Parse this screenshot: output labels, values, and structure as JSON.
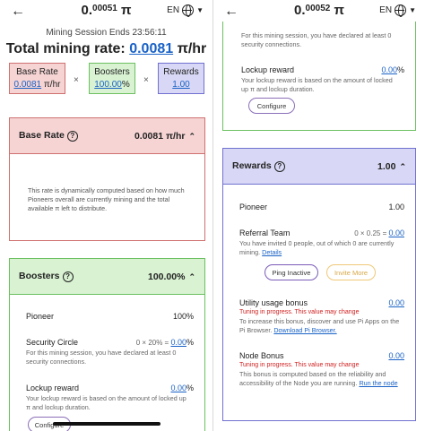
{
  "left": {
    "header": {
      "balance_main": "0.",
      "balance_small": "00051",
      "balance_unit": " π",
      "lang": "EN"
    },
    "session": "Mining Session Ends 23:56:11",
    "total": {
      "label": "Total mining rate: ",
      "value": "0.0081",
      "unit": " π/hr"
    },
    "chips": {
      "base": {
        "label": "Base Rate",
        "value": "0.0081",
        "unit": " π/hr"
      },
      "boosters": {
        "label": "Boosters",
        "value": "100.00",
        "unit": "%"
      },
      "rewards": {
        "label": "Rewards",
        "value": "1.00"
      }
    },
    "base_card": {
      "title": "Base Rate",
      "value": "0.0081 π/hr",
      "desc": "This rate is dynamically computed based on how much Pioneers overall are currently mining and the total available π left to distribute."
    },
    "boosters_card": {
      "title": "Boosters",
      "value": "100.00%",
      "pioneer": {
        "label": "Pioneer",
        "value": "100%"
      },
      "security": {
        "label": "Security Circle",
        "formula": "0 × 20% = ",
        "value": "0.00",
        "unit": "%",
        "desc": "For this mining session, you have declared at least 0 security connections."
      },
      "lockup": {
        "label": "Lockup reward",
        "value": "0.00",
        "unit": "%",
        "desc": "Your lockup reward is based on the amount of locked up π and lockup duration."
      },
      "configure": "Configure"
    }
  },
  "right": {
    "header": {
      "balance_main": "0.",
      "balance_small": "00052",
      "balance_unit": " π",
      "lang": "EN"
    },
    "top_desc": "For this mining session, you have declared at least 0 security connections.",
    "lockup": {
      "label": "Lockup reward",
      "value": "0.00",
      "unit": "%",
      "desc": "Your lockup reward is based on the amount of locked up π and lockup duration."
    },
    "configure": "Configure",
    "rewards_card": {
      "title": "Rewards",
      "value": "1.00",
      "pioneer": {
        "label": "Pioneer",
        "value": "1.00"
      },
      "referral": {
        "label": "Referral Team",
        "formula": "0 × 0.25 = ",
        "value": "0.00",
        "desc": "You have invited 0 people, out of which 0 are currently mining. ",
        "details": "Details"
      },
      "ping": "Ping Inactive",
      "invite": "Invite More",
      "utility": {
        "label": "Utility usage bonus",
        "value": "0.00",
        "warn": "Tuning in progress. This value may change",
        "desc": "To increase this bonus, discover and use Pi Apps on the Pi Browser. ",
        "link": "Download Pi Browser."
      },
      "node": {
        "label": "Node Bonus",
        "value": "0.00",
        "warn": "Tuning in progress. This value may change",
        "desc": "This bonus is computed based on the reliability and accessibility of the Node you are running. ",
        "link": "Run the node"
      }
    }
  },
  "colors": {
    "base_bg": "#f6d4d4",
    "base_border": "#d07070",
    "boost_bg": "#d8f2d2",
    "boost_border": "#6cc060",
    "rewards_bg": "#d8d8f6",
    "rewards_border": "#7070d0",
    "link": "#1a62c6",
    "warn": "#d02020"
  }
}
